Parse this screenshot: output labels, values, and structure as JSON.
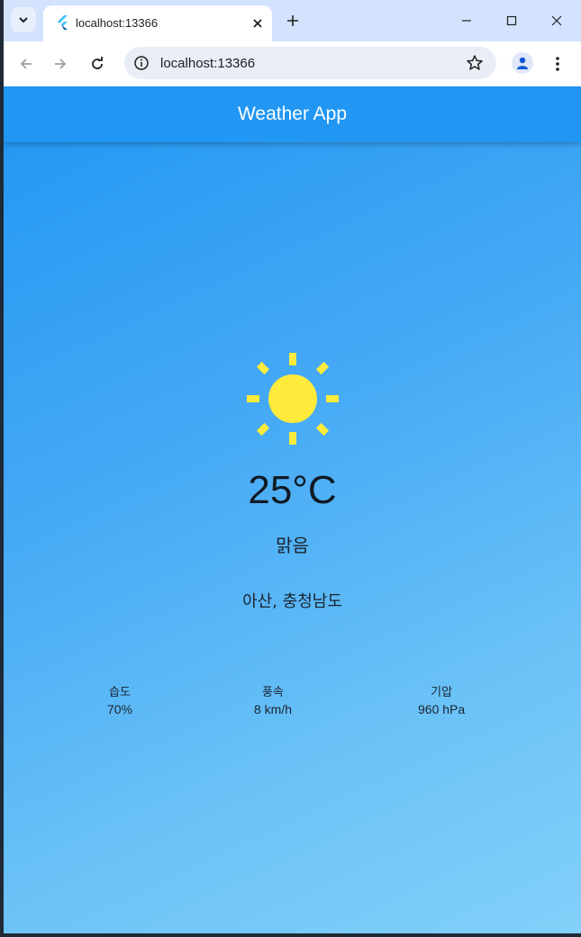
{
  "browser": {
    "tab_title": "localhost:13366",
    "url": "localhost:13366",
    "new_tab": "+"
  },
  "app": {
    "title": "Weather App",
    "temperature": "25°C",
    "condition": "맑음",
    "location": "아산, 충청남도",
    "stats": [
      {
        "label": "습도",
        "value": "70%"
      },
      {
        "label": "풍속",
        "value": "8 km/h"
      },
      {
        "label": "기압",
        "value": "960 hPa"
      }
    ],
    "colors": {
      "appbar": "#2196f3",
      "gradient_start": "#2196f3",
      "gradient_end": "#82d0f9",
      "sun": "#ffeb3b"
    },
    "weather_icon": "sun-icon"
  }
}
